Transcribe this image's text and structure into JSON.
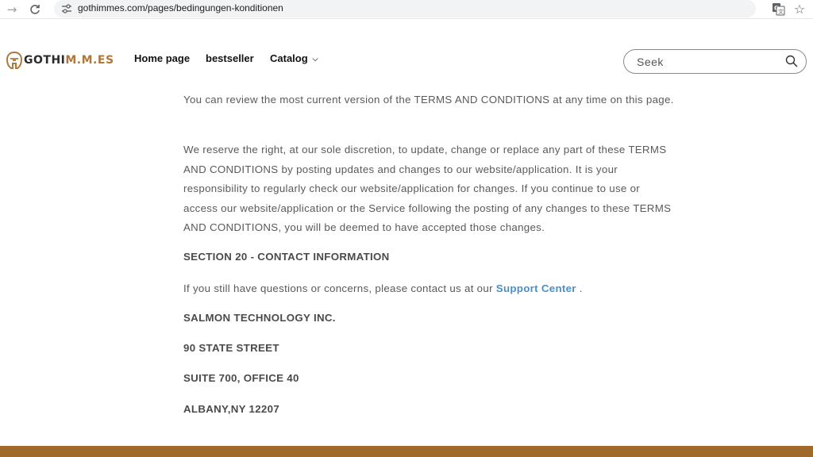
{
  "browser": {
    "url": "gothimmes.com/pages/bedingungen-konditionen",
    "back_icon": "arrow-left-icon",
    "reload_icon": "reload-icon"
  },
  "header": {
    "logo": {
      "part1": "GOTHI",
      "part2": "M.M.ES"
    },
    "nav": [
      {
        "label": "Home page"
      },
      {
        "label": "bestseller"
      },
      {
        "label": "Catalog"
      }
    ],
    "search": {
      "placeholder": "Seek",
      "value": ""
    }
  },
  "content": {
    "p1": "You can review the most current version of the TERMS AND CONDITIONS at any time on this page.",
    "p2": "We reserve the right, at our sole discretion, to update, change or replace any part of these TERMS AND CONDITIONS by posting updates and changes to our website/application. It is your responsibility to regularly check our website/application for changes. If you continue to use or access our website/application or the Service following the posting of any changes to these TERMS AND CONDITIONS, you will be deemed to have accepted those changes.",
    "section_heading": "SECTION 20 - CONTACT INFORMATION",
    "contact_text": "If you still have questions or concerns, please contact us at our ",
    "support_link": "Support Center",
    "contact_end": " .",
    "address": [
      "SALMON TECHNOLOGY INC.",
      "90 STATE STREET",
      "SUITE 700, OFFICE 40",
      "ALBANY,NY 12207"
    ]
  },
  "colors": {
    "accent_gold": "#b0773a",
    "footer": "#a06a2c",
    "link": "#4a8fc9"
  }
}
